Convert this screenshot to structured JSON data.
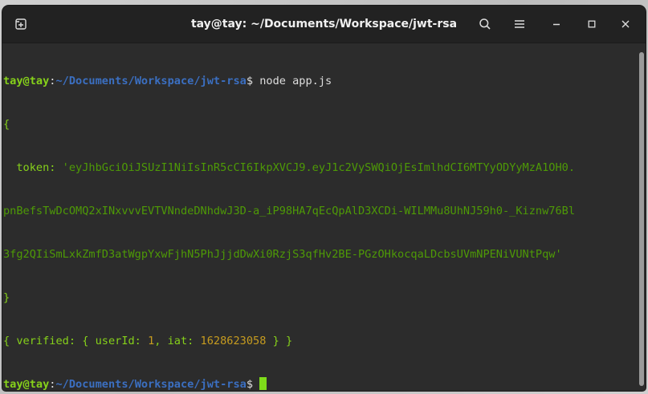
{
  "window": {
    "title": "tay@tay: ~/Documents/Workspace/jwt-rsa"
  },
  "titlebar": {
    "new_tab_icon": "new-tab-icon",
    "search_icon": "search-icon",
    "menu_icon": "hamburger-menu-icon",
    "minimize_icon": "minimize-icon",
    "maximize_icon": "maximize-icon",
    "close_icon": "close-icon"
  },
  "terminal": {
    "prompt_user": "tay@tay",
    "prompt_colon": ":",
    "prompt_path": "~/Documents/Workspace/jwt-rsa",
    "prompt_dollar": "$ ",
    "command": "node app.js",
    "open_brace": "{",
    "token_key": "  token: ",
    "token_line1": "'eyJhbGciOiJSUzI1NiIsInR5cCI6IkpXVCJ9.eyJ1c2VySWQiOjEsImlhdCI6MTYyODYyMzA1OH0.",
    "token_line2": "pnBefsTwDcOMQ2xINxvvvEVTVNndeDNhdwJ3D-a_iP98HA7qEcQpAlD3XCDi-WILMMu8UhNJ59h0-_Kiznw76Bl",
    "token_line3": "3fg2QIiSmLxkZmfD3atWgpYxwFjhN5PhJjjdDwXi0RzjS3qfHv2BE-PGzOHkocqaLDcbsUVmNPENiVUNtPqw'",
    "close_brace": "}",
    "verified_open": "{ verified: { userId: ",
    "user_id": "1",
    "iat_label": ", iat: ",
    "iat_value": "1628623058",
    "verified_close": " } }"
  },
  "colors": {
    "prompt_user": "#86d11a",
    "prompt_path": "#3b6fc1",
    "string": "#4e9a06",
    "number": "#c79c1f",
    "background": "#2c2c2c",
    "cursor": "#7edc1a"
  }
}
